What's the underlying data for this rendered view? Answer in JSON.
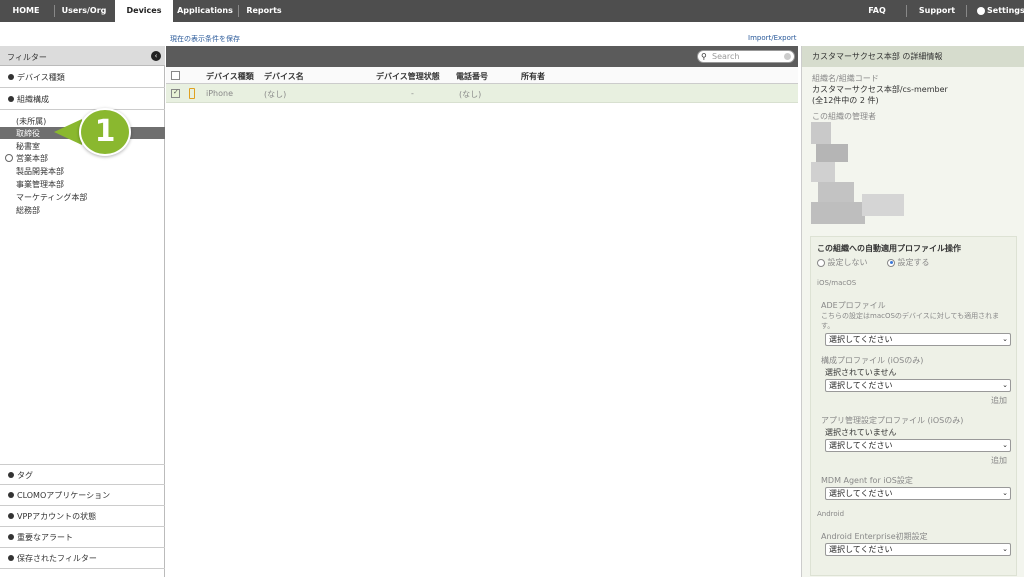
{
  "topnav": {
    "tabs": [
      "HOME",
      "Users/Org",
      "Devices",
      "Applications",
      "Reports"
    ],
    "right": [
      "FAQ",
      "Support",
      "Settings"
    ]
  },
  "subbar": {
    "save_view": "現在の表示条件を保存",
    "import_export": "Import/Export"
  },
  "sidebar": {
    "title": "フィルター",
    "sections_top": [
      "デバイス種類",
      "組織構成"
    ],
    "orgs": [
      "(未所属)",
      "取締役",
      "秘書室",
      "営業本部",
      "製品開発本部",
      "事業管理本部",
      "マーケティング本部",
      "総務部"
    ],
    "sections_bottom": [
      "タグ",
      "CLOMOアプリケーション",
      "VPPアカウントの状態",
      "重要なアラート",
      "保存されたフィルター"
    ]
  },
  "callout": "1",
  "main": {
    "search_placeholder": "Search",
    "columns": [
      "デバイス種類",
      "デバイス名",
      "デバイス管理状態",
      "電話番号",
      "所有者"
    ],
    "row": {
      "type": "iPhone",
      "name": "(なし)",
      "state": "-",
      "phone": "(なし)",
      "owner": ""
    }
  },
  "detail": {
    "title": "カスタマーサクセス本部 の詳細情報",
    "org_label": "組織名/組織コード",
    "org_value": "カスタマーサクセス本部/cs-member",
    "count": "(全12件中の 2 件)",
    "admin_label": "この組織の管理者",
    "profile_title": "この組織への自動適用プロファイル操作",
    "radio_off": "設定しない",
    "radio_on": "設定する",
    "ios_label": "iOS/macOS",
    "ade_label": "ADEプロファイル",
    "ade_note1": "こちらの設定はmacOSのデバイスに対しても適用されま",
    "ade_note2": "す。",
    "select_placeholder": "選択してください",
    "config_label": "構成プロファイル (iOSのみ)",
    "not_selected": "選択されていません",
    "add": "追加",
    "app_label": "アプリ管理設定プロファイル (iOSのみ)",
    "mdm_label": "MDM Agent for iOS設定",
    "android_label": "Android",
    "ae_label": "Android Enterprise初期設定"
  }
}
